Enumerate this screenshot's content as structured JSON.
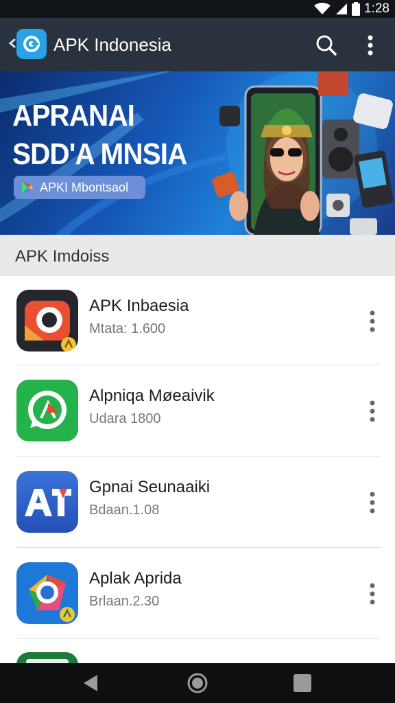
{
  "status_bar": {
    "time": "1:28",
    "icons": [
      "wifi-icon",
      "signal-icon",
      "battery-icon"
    ]
  },
  "app_bar": {
    "title": "APK Indonesia",
    "search_icon": "search-icon",
    "more_icon": "more-vertical-icon"
  },
  "banner": {
    "line1": "APRANAI",
    "line2": "SDD'A MNSIA",
    "chip_label": "APKI Mbontsaol"
  },
  "section": {
    "title": "APK Imdoiss"
  },
  "apps": [
    {
      "name": "APK Inbaesia",
      "meta": "Mtata: 1.600",
      "icon": "red-camera-app-icon",
      "color": "#e8472e"
    },
    {
      "name": "Alpniqa Møeaivik",
      "meta": "Udara 1800",
      "icon": "green-chat-app-icon",
      "color": "#25b14a"
    },
    {
      "name": "Gpnai Seunaaiki",
      "meta": "Bdaan.1.08",
      "icon": "blue-a-app-icon",
      "color": "#2f5fc4"
    },
    {
      "name": "Aplak Aprida",
      "meta": "Brlaan.2.30",
      "icon": "blue-chrome-app-icon",
      "color": "#1e78d8"
    },
    {
      "name": "",
      "meta": "",
      "icon": "green-app-icon",
      "color": "#1e8a3a"
    }
  ],
  "colors": {
    "app_bar": "#2a333d",
    "accent": "#2aa0e6",
    "section_bg": "#e9e9e9"
  }
}
